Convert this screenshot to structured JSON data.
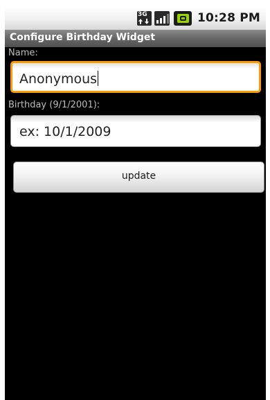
{
  "status_bar": {
    "network_icon": "3g-data-icon",
    "network_text": "3G",
    "signal_icon": "signal-strength-icon",
    "battery_icon": "battery-charging-icon",
    "time": "10:28 PM"
  },
  "title_bar": {
    "title": "Configure Birthday Widget"
  },
  "form": {
    "name_label": "Name:",
    "name_value": "Anonymous",
    "birthday_label": "Birthday (9/1/2001):",
    "birthday_placeholder": "ex: 10/1/2009",
    "update_label": "update"
  },
  "colors": {
    "focus_border": "#ff9a00",
    "background": "#000000",
    "battery_green": "#9ad400"
  }
}
